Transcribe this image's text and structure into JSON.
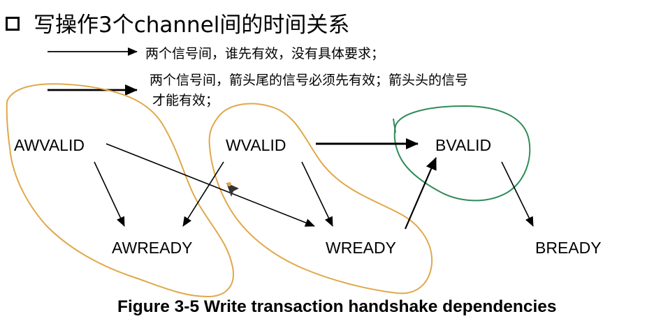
{
  "title": "写操作3个channel间的时间关系",
  "legend": {
    "thin_arrow_text": "两个信号间，谁先有效，没有具体要求；",
    "thick_arrow_text_line1": "两个信号间，箭头尾的信号必须先有效；箭头头的信号",
    "thick_arrow_text_line2": "才能有效；"
  },
  "nodes": {
    "awvalid": "AWVALID",
    "wvalid": "WVALID",
    "bvalid": "BVALID",
    "awready": "AWREADY",
    "wready": "WREADY",
    "bready": "BREADY"
  },
  "caption": "Figure 3-5 Write transaction handshake dependencies",
  "colors": {
    "annotation_orange": "#e0a84a",
    "annotation_green": "#2e8b57",
    "arrow": "#000000"
  }
}
